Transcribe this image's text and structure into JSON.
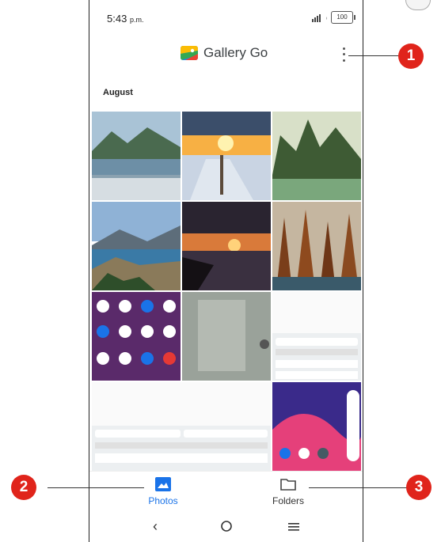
{
  "status_bar": {
    "time": "5:43",
    "time_suffix": "p.m.",
    "battery": "100"
  },
  "app_bar": {
    "title": "Gallery Go"
  },
  "section": {
    "title": "August"
  },
  "bottom_nav": [
    {
      "label": "Photos",
      "icon": "photo-icon"
    },
    {
      "label": "Folders",
      "icon": "folder-icon"
    }
  ],
  "callouts": [
    "1",
    "2",
    "3"
  ],
  "colors": {
    "accent": "#1a73e8",
    "callout": "#e0241b"
  }
}
